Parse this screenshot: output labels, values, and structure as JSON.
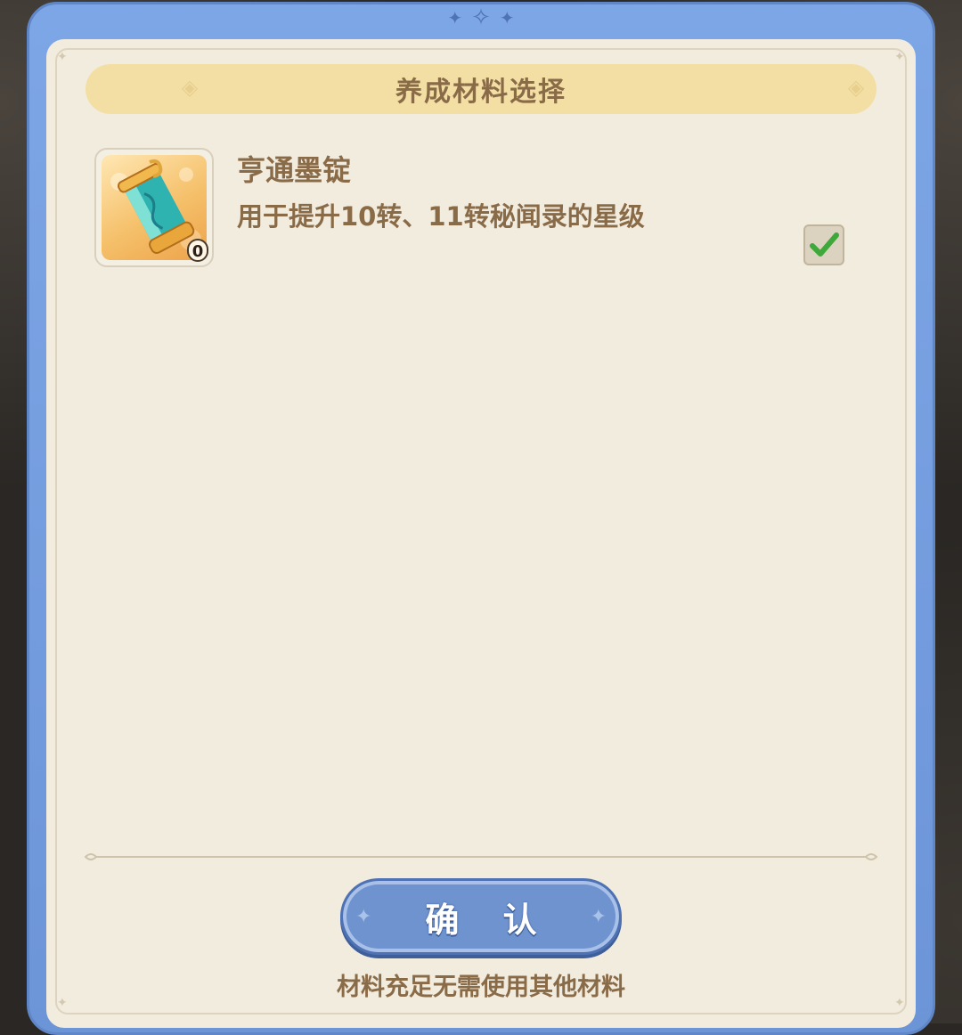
{
  "dialog": {
    "title": "养成材料选择",
    "confirm_label": "确 认",
    "footer_note": "材料充足无需使用其他材料"
  },
  "materials": [
    {
      "name": "亨通墨锭",
      "description": "用于提升10转、11转秘闻录的星级",
      "count": "0",
      "selected": true,
      "icon": "ink-stick-icon"
    }
  ],
  "colors": {
    "frame_blue": "#7da6e6",
    "panel_cream": "#f2ecdf",
    "title_gold": "#f3dfa4",
    "text_brown": "#8a6b48",
    "button_blue": "#6f93cf",
    "check_green": "#3ea83a"
  }
}
